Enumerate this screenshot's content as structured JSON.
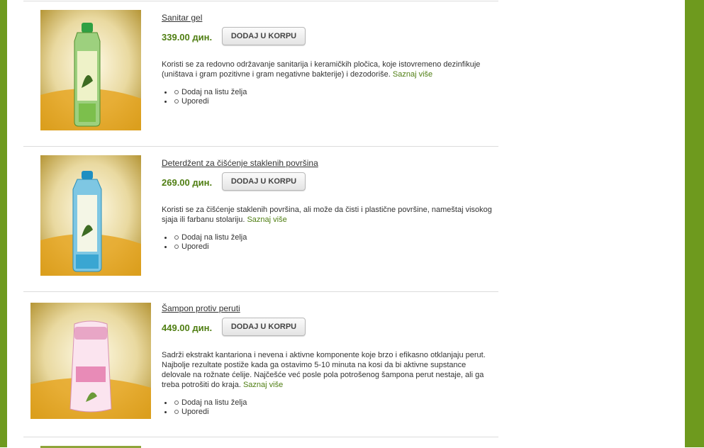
{
  "products": [
    {
      "title": "Sanitar gel",
      "price": "339.00 дин.",
      "button": "DODAJ U KORPU",
      "description": "Koristi se za redovno održavanje sanitarija i keramičkih pločica, koje istovremeno dezinfikuje (uništava i gram pozitivne i gram negativne bakterije) i dezodoriše.",
      "more": "Saznaj više",
      "wishlist": "Dodaj na listu želja",
      "compare": "Uporedi"
    },
    {
      "title": "Deterdžent za čišćenje staklenih površina",
      "price": "269.00 дин.",
      "button": "DODAJ U KORPU",
      "description": "Koristi se za čišćenje staklenih površina, ali može da čisti i plastične površine, nameštaj visokog sjaja ili farbanu stolariju.",
      "more": "Saznaj više",
      "wishlist": "Dodaj na listu želja",
      "compare": "Uporedi"
    },
    {
      "title": "Šampon protiv peruti",
      "price": "449.00 дин.",
      "button": "DODAJ U KORPU",
      "description": "Sadrži ekstrakt kantariona i nevena i aktivne komponente koje brzo i efikasno otklanjaju perut. Najbolje rezultate postiže kada ga ostavimo 5-10 minuta na kosi da bi aktivne supstance delovale na rožnate ćelije. Najčešće već posle pola potrošenog šampona perut nestaje, ali ga treba potrošiti do kraja.",
      "more": "Saznaj više",
      "wishlist": "Dodaj na listu želja",
      "compare": "Uporedi"
    }
  ],
  "colors": {
    "brand_green": "#6e9a1e",
    "price_green": "#4f7e12"
  }
}
